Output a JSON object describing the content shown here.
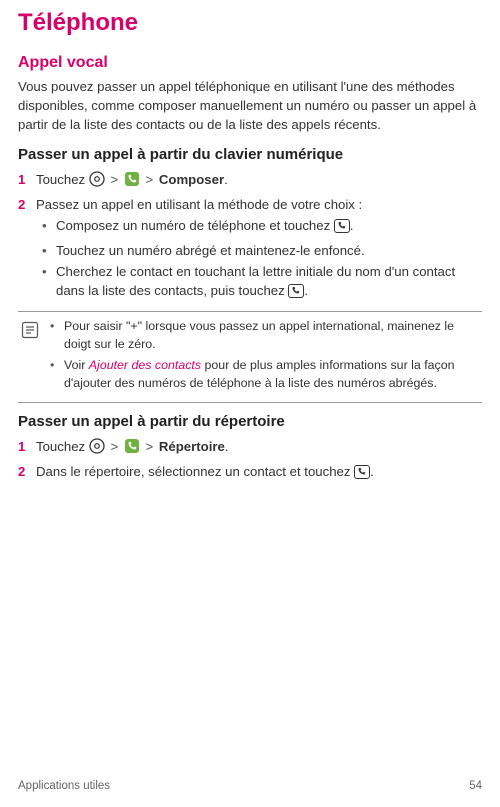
{
  "title": "Téléphone",
  "subTitle": "Appel vocal",
  "intro": "Vous pouvez passer un appel téléphonique en utilisant l'une des méthodes disponibles, comme composer manuellement un numéro ou passer un appel à partir de la liste des contacts ou de la liste des appels récents.",
  "section1": {
    "heading": "Passer un appel à partir du clavier numérique",
    "step1a": "Touchez ",
    "step1b": "Composer",
    "step1c": ".",
    "step2": "Passez un appel en utilisant la méthode de votre choix :",
    "b1a": "Composez un numéro de téléphone et touchez ",
    "b1b": ".",
    "b2": "Touchez un numéro abrégé et maintenez-le enfoncé.",
    "b3a": "Cherchez le contact en touchant la lettre initiale du nom d'un contact dans la liste des contacts, puis touchez ",
    "b3b": "."
  },
  "note": {
    "n1": "Pour saisir \"+\" lorsque vous passez un appel international, mainenez le doigt sur le zéro.",
    "n2a": "Voir ",
    "n2link": "Ajouter des contacts",
    "n2b": " pour de plus amples informations sur la façon d'ajouter des numéros de téléphone à la liste des numéros abrégés."
  },
  "section2": {
    "heading": "Passer un appel à partir du répertoire",
    "step1a": "Touchez ",
    "step1b": "Répertoire",
    "step1c": ".",
    "step2a": "Dans le répertoire, sélectionnez un contact et touchez ",
    "step2b": "."
  },
  "footer": {
    "left": "Applications utiles",
    "right": "54"
  }
}
